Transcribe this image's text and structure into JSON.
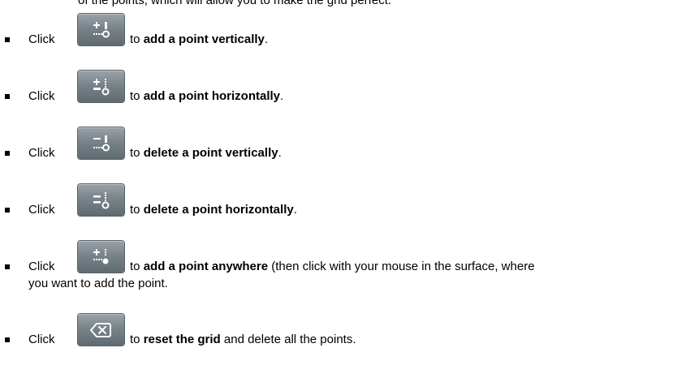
{
  "top_fragment": "of the points, which will allow you to make the grid perfect.",
  "items": [
    {
      "click": "Click",
      "to": "to",
      "bold": "add a point vertically",
      "rest": ".",
      "icon": "add-point-vertical-icon"
    },
    {
      "click": "Click",
      "to": "to",
      "bold": "add a point horizontally",
      "rest": ".",
      "icon": "add-point-horizontal-icon"
    },
    {
      "click": "Click",
      "to": "to",
      "bold": "delete a point vertically",
      "rest": ".",
      "icon": "delete-point-vertical-icon"
    },
    {
      "click": "Click",
      "to": "to",
      "bold": "delete a point horizontally",
      "rest": ".",
      "icon": "delete-point-horizontal-icon"
    },
    {
      "click": "Click",
      "to": "to",
      "bold": "add a point anywhere",
      "rest": " (then click with your mouse in the surface, where",
      "rest_line2": "you want to add the point.",
      "icon": "add-point-anywhere-icon"
    },
    {
      "click": "Click",
      "to": "to",
      "bold": "reset the grid",
      "rest": " and delete all the points.",
      "icon": "reset-grid-icon"
    }
  ]
}
